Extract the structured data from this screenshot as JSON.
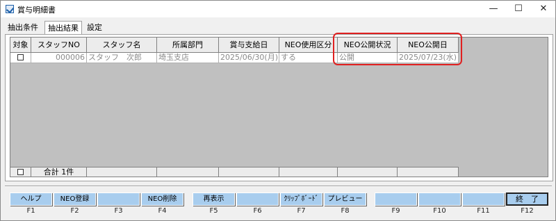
{
  "window": {
    "title": "賞与明細書",
    "controls": {
      "minimize": "—",
      "maximize": "☐",
      "close": "✕"
    }
  },
  "tabs": [
    {
      "label": "抽出条件"
    },
    {
      "label": "抽出結果",
      "active": true
    },
    {
      "label": "設定"
    }
  ],
  "grid": {
    "columns": [
      "対象",
      "スタッフNO",
      "スタッフ名",
      "所属部門",
      "賞与支給日",
      "NEO使用区分",
      "NEO公開状況",
      "NEO公開日"
    ],
    "rows": [
      {
        "checked": false,
        "staff_no": "000006",
        "staff_name": "スタッフ　次郎",
        "department": "埼玉支店",
        "pay_date": "2025/06/30(月)",
        "neo_usage": "する",
        "neo_status": "公開",
        "neo_date": "2025/07/23(水)"
      }
    ],
    "footer": {
      "total_label": "合計 1件"
    }
  },
  "highlight": {
    "color": "#e02020"
  },
  "function_keys": [
    {
      "label": "ヘルプ",
      "key": "F1"
    },
    {
      "label": "NEO登録",
      "key": "F2"
    },
    {
      "label": "",
      "key": "F3"
    },
    {
      "label": "NEO削除",
      "key": "F4"
    },
    {
      "label": "再表示",
      "key": "F5"
    },
    {
      "label": "",
      "key": "F6"
    },
    {
      "label": "ｸﾘｯﾌﾟﾎﾞｰﾄﾞ",
      "key": "F7"
    },
    {
      "label": "プレビュー",
      "key": "F8"
    },
    {
      "label": "",
      "key": "F9"
    },
    {
      "label": "",
      "key": "F10"
    },
    {
      "label": "",
      "key": "F11"
    },
    {
      "label": "終　了",
      "key": "F12"
    }
  ],
  "colors": {
    "fkey_button": "#a8cdee",
    "grid_bg": "#c0c0c0"
  }
}
